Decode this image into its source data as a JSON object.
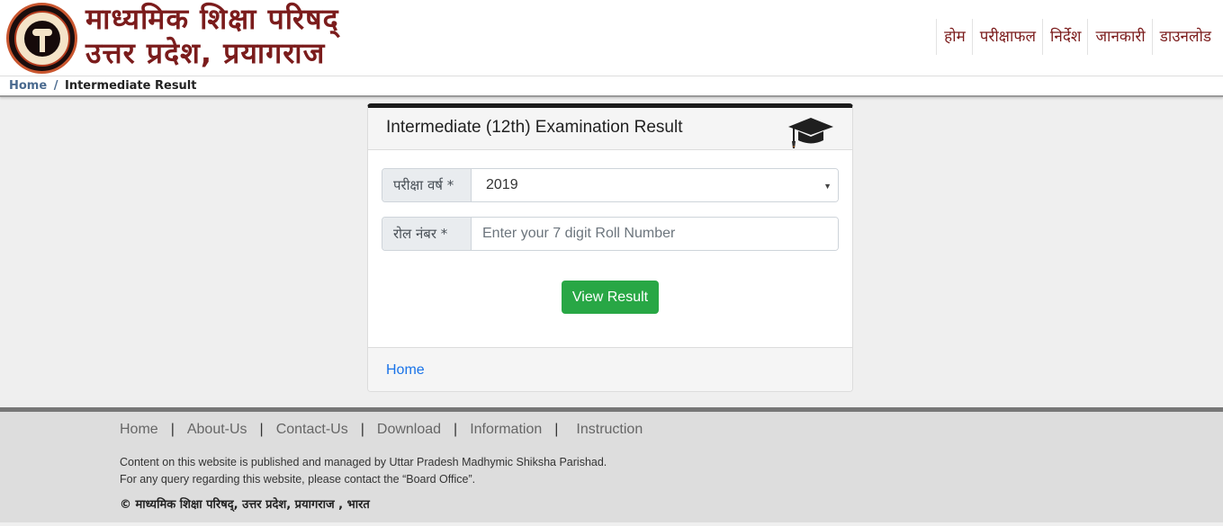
{
  "header": {
    "logo_alt": "UP Board emblem",
    "title_line1": "माध्यमिक शिक्षा परिषद्",
    "title_line2": "उत्तर प्रदेश, प्रयागराज",
    "nav": [
      {
        "label": "होम"
      },
      {
        "label": "परीक्षाफल"
      },
      {
        "label": "निर्देश"
      },
      {
        "label": "जानकारी"
      },
      {
        "label": "डाउनलोड"
      }
    ]
  },
  "breadcrumb": {
    "home": "Home",
    "separator": "/",
    "current": "Intermediate Result"
  },
  "card": {
    "title": "Intermediate (12th) Examination Result",
    "icon": "graduation-cap-icon",
    "year_label": "परीक्षा वर्ष *",
    "year_value": "2019",
    "roll_label": "रोल नंबर *",
    "roll_value": "",
    "roll_placeholder": "Enter your 7 digit Roll Number",
    "submit_label": "View Result",
    "footer_link": "Home"
  },
  "footer": {
    "links": [
      "Home",
      "About-Us",
      "Contact-Us",
      "Download",
      "Information",
      "Instruction"
    ],
    "text_line1": "Content on this website is published and managed by Uttar Pradesh Madhymic Shiksha Parishad.",
    "text_line2": "For any query regarding this website, please contact the “Board Office”.",
    "copyright": "©  माध्यमिक शिक्षा परिषद्, उत्तर प्रदेश, प्रयागराज , भारत"
  },
  "colors": {
    "brand": "#7b1c1c",
    "button": "#28a745",
    "link": "#1a73e8",
    "card_top_border": "#1b1b1b",
    "footer_bg": "#dddddd"
  }
}
